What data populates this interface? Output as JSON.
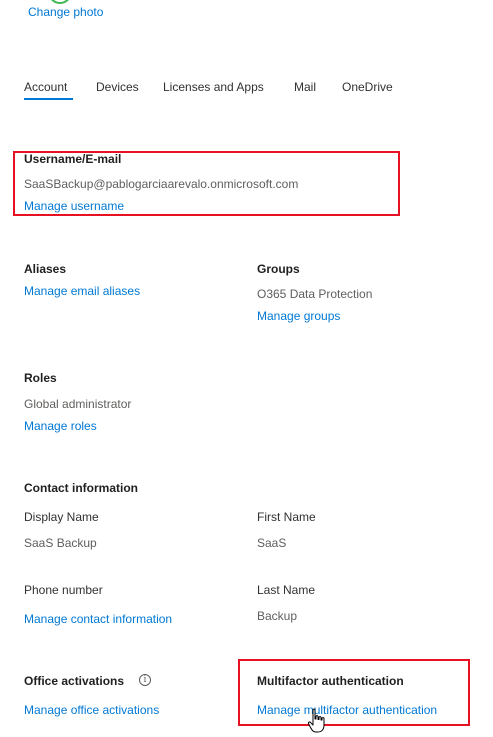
{
  "header": {
    "change_photo": "Change photo"
  },
  "tabs": [
    {
      "label": "Account",
      "selected": true
    },
    {
      "label": "Devices"
    },
    {
      "label": "Licenses and Apps"
    },
    {
      "label": "Mail"
    },
    {
      "label": "OneDrive"
    }
  ],
  "username": {
    "heading": "Username/E-mail",
    "value": "SaaSBackup@pablogarciaarevalo.onmicrosoft.com",
    "link": "Manage username"
  },
  "aliases": {
    "heading": "Aliases",
    "link": "Manage email aliases"
  },
  "groups": {
    "heading": "Groups",
    "value": "O365 Data Protection",
    "link": "Manage groups"
  },
  "roles": {
    "heading": "Roles",
    "value": "Global administrator",
    "link": "Manage roles"
  },
  "contact": {
    "heading": "Contact information",
    "display_name_label": "Display Name",
    "display_name_value": "SaaS Backup",
    "first_name_label": "First Name",
    "first_name_value": "SaaS",
    "phone_label": "Phone number",
    "last_name_label": "Last Name",
    "last_name_value": "Backup",
    "link": "Manage contact information"
  },
  "office": {
    "heading": "Office activations",
    "info_glyph": "i",
    "link": "Manage office activations"
  },
  "mfa": {
    "heading": "Multifactor authentication",
    "link": "Manage multifactor authentication"
  },
  "colors": {
    "accent": "#0078d4",
    "highlight": "#e81123"
  }
}
